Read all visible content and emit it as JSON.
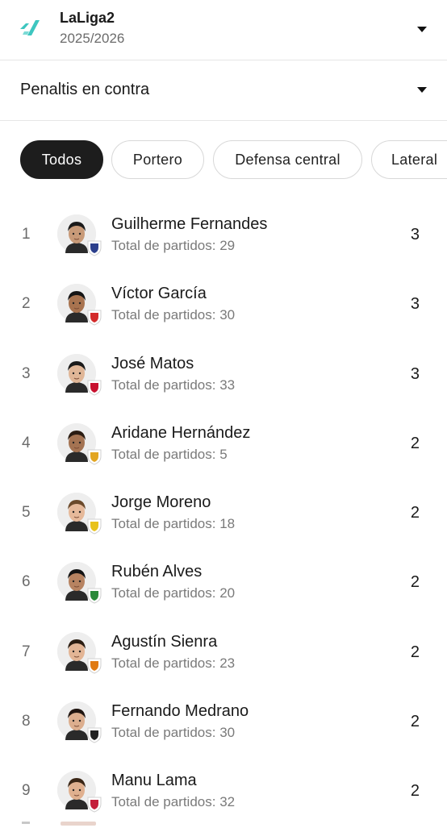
{
  "header": {
    "league_name": "LaLiga2",
    "season": "2025/2026",
    "logo_icon": "laliga-logo-icon",
    "accent": "#3ec6c0"
  },
  "stat_selector": {
    "label": "Penaltis en contra"
  },
  "filters": [
    {
      "label": "Todos",
      "active": true
    },
    {
      "label": "Portero",
      "active": false
    },
    {
      "label": "Defensa central",
      "active": false
    },
    {
      "label": "Lateral",
      "active": false
    }
  ],
  "players": [
    {
      "rank": "1",
      "name": "Guilherme Fernandes",
      "sub": "Total de partidos: 29",
      "value": "3",
      "skin": "#c89a78",
      "hair": "#1b1b1b",
      "badge": "#2b3f8c"
    },
    {
      "rank": "2",
      "name": "Víctor García",
      "sub": "Total de partidos: 30",
      "value": "3",
      "skin": "#a8734f",
      "hair": "#151515",
      "badge": "#d32a2a"
    },
    {
      "rank": "3",
      "name": "José Matos",
      "sub": "Total de partidos: 33",
      "value": "3",
      "skin": "#e0b697",
      "hair": "#1a1a1a",
      "badge": "#c8102e"
    },
    {
      "rank": "4",
      "name": "Aridane Hernández",
      "sub": "Total de partidos: 5",
      "value": "2",
      "skin": "#a47352",
      "hair": "#2a1c12",
      "badge": "#e2a521"
    },
    {
      "rank": "5",
      "name": "Jorge Moreno",
      "sub": "Total de partidos: 18",
      "value": "2",
      "skin": "#e6b99a",
      "hair": "#6b4a2b",
      "badge": "#e8c21a"
    },
    {
      "rank": "6",
      "name": "Rubén Alves",
      "sub": "Total de partidos: 20",
      "value": "2",
      "skin": "#b78361",
      "hair": "#141414",
      "badge": "#2a8a3a"
    },
    {
      "rank": "7",
      "name": "Agustín Sienra",
      "sub": "Total de partidos: 23",
      "value": "2",
      "skin": "#e3b595",
      "hair": "#2b1d12",
      "badge": "#e07a12"
    },
    {
      "rank": "8",
      "name": "Fernando Medrano",
      "sub": "Total de partidos: 30",
      "value": "2",
      "skin": "#dcae8e",
      "hair": "#201510",
      "badge": "#222222"
    },
    {
      "rank": "9",
      "name": "Manu Lama",
      "sub": "Total de partidos: 32",
      "value": "2",
      "skin": "#e0b08f",
      "hair": "#3a2616",
      "badge": "#c41e3a"
    }
  ]
}
